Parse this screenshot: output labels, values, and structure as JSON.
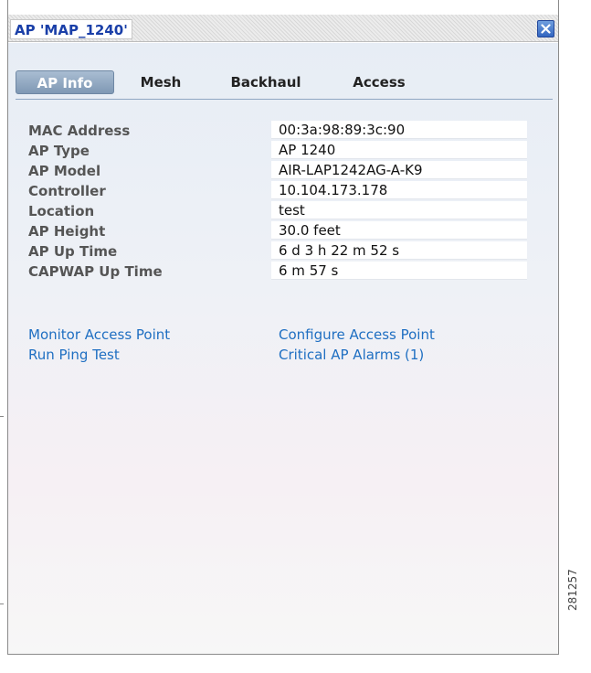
{
  "window": {
    "title": "AP 'MAP_1240'",
    "close_icon": "close-icon"
  },
  "tabs": [
    {
      "label": "AP Info",
      "active": true
    },
    {
      "label": "Mesh",
      "active": false
    },
    {
      "label": "Backhaul",
      "active": false
    },
    {
      "label": "Access",
      "active": false
    }
  ],
  "ap_info": [
    {
      "label": "MAC Address",
      "value": "00:3a:98:89:3c:90"
    },
    {
      "label": "AP Type",
      "value": "AP 1240"
    },
    {
      "label": "AP Model",
      "value": "AIR-LAP1242AG-A-K9"
    },
    {
      "label": "Controller",
      "value": "10.104.173.178"
    },
    {
      "label": "Location",
      "value": "test"
    },
    {
      "label": "AP Height",
      "value": "30.0 feet"
    },
    {
      "label": "AP Up Time",
      "value": "6 d 3 h 22 m 52 s"
    },
    {
      "label": "CAPWAP Up Time",
      "value": "6 m 57 s"
    }
  ],
  "links": {
    "monitor": "Monitor Access Point",
    "configure": "Configure Access Point",
    "ping": "Run Ping Test",
    "alarms": "Critical AP Alarms (1)"
  },
  "figure_id": "281257",
  "colors": {
    "title_text": "#1a3fa8",
    "link": "#1f6fc2",
    "active_tab": "#8fa7c3"
  }
}
